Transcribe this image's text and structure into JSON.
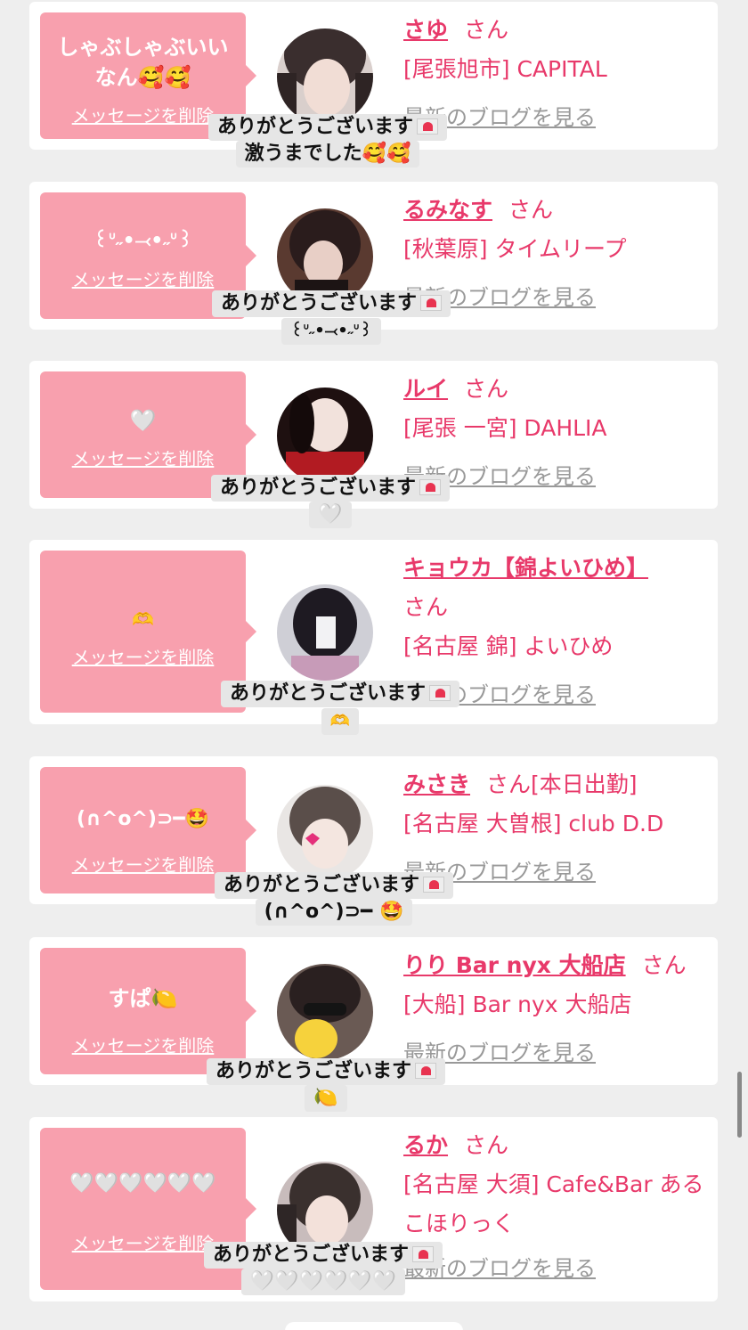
{
  "delete_label": "メッセージを削除",
  "blog_label": "最新のブログを見る",
  "honorific": "さん",
  "reply_prefix": "ありがとうございます",
  "icons": {
    "reply_envelope": "love-letter-icon"
  },
  "colors": {
    "accent": "#e8396a",
    "bubble": "#f8a0ae",
    "card": "#ffffff",
    "background": "#eeeeee",
    "muted_link": "#999999"
  },
  "entries": [
    {
      "name": "さゆ",
      "status": "",
      "shop": "[尾張旭市] CAPITAL",
      "message": "しゃぶしゃぶいいなん🥰🥰",
      "reply_tail": "激うまでした🥰🥰"
    },
    {
      "name": "るみなす",
      "status": "",
      "shop": "[秋葉原] タイムリープ",
      "message": "꒰ᐡ˶•⤙•˶ᐡ꒱",
      "reply_tail": "꒰ᐡ˶•⤙•˶ᐡ꒱"
    },
    {
      "name": "ルイ",
      "status": "",
      "shop": "[尾張 一宮] DAHLIA",
      "message": "🤍",
      "reply_tail": "🤍"
    },
    {
      "name": "キョウカ【錦よいひめ】",
      "status": "",
      "shop": "[名古屋 錦] よいひめ",
      "message": "🫶",
      "reply_tail": "🫶"
    },
    {
      "name": "みさき",
      "status": "[本日出勤]",
      "shop": "[名古屋 大曽根] club D.D",
      "message": "(∩^o^)⊃━🤩",
      "reply_tail": "(∩^o^)⊃━ 🤩"
    },
    {
      "name": "りり Bar nyx 大船店",
      "status": "",
      "shop": "[大船] Bar nyx 大船店",
      "message": "すぱ🍋",
      "reply_tail": "🍋"
    },
    {
      "name": "るか",
      "status": "",
      "shop": "[名古屋 大須] Cafe&Bar あるこほりっく",
      "message": "🤍🤍🤍🤍🤍🤍",
      "reply_tail": "🤍🤍🤍🤍🤍🤍"
    }
  ]
}
